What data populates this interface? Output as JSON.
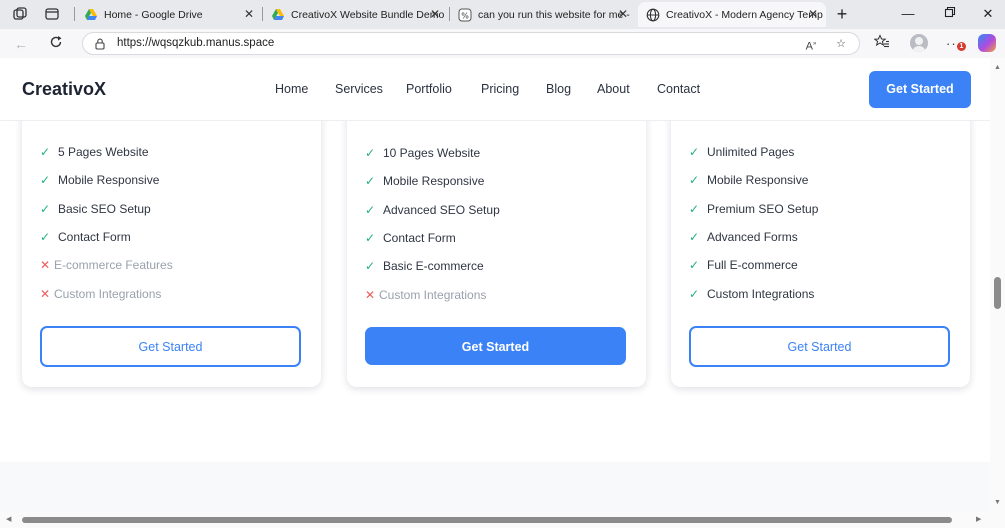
{
  "browser": {
    "tabs": [
      {
        "title": "Home - Google Drive",
        "icon": "google-drive-icon"
      },
      {
        "title": "CreativoX Website Bundle Demo",
        "icon": "google-drive-icon"
      },
      {
        "title": "can you run this website for me -",
        "icon": "manus-icon"
      },
      {
        "title": "CreativoX - Modern Agency Temp",
        "icon": "globe-icon",
        "active": true
      }
    ],
    "url": "https://wqsqzkub.manus.space",
    "notification_count": "1"
  },
  "site": {
    "logo": "CreativoX",
    "nav": [
      "Home",
      "Services",
      "Portfolio",
      "Pricing",
      "Blog",
      "About",
      "Contact"
    ],
    "cta": "Get Started"
  },
  "pricing": {
    "cards": [
      {
        "features": [
          {
            "text": "5 Pages Website",
            "included": true
          },
          {
            "text": "Mobile Responsive",
            "included": true
          },
          {
            "text": "Basic SEO Setup",
            "included": true
          },
          {
            "text": "Contact Form",
            "included": true
          },
          {
            "text": "E-commerce Features",
            "included": false
          },
          {
            "text": "Custom Integrations",
            "included": false
          }
        ],
        "button": "Get Started",
        "button_style": "outline"
      },
      {
        "features": [
          {
            "text": "10 Pages Website",
            "included": true
          },
          {
            "text": "Mobile Responsive",
            "included": true
          },
          {
            "text": "Advanced SEO Setup",
            "included": true
          },
          {
            "text": "Contact Form",
            "included": true
          },
          {
            "text": "Basic E-commerce",
            "included": true
          },
          {
            "text": "Custom Integrations",
            "included": false
          }
        ],
        "button": "Get Started",
        "button_style": "solid"
      },
      {
        "features": [
          {
            "text": "Unlimited Pages",
            "included": true
          },
          {
            "text": "Mobile Responsive",
            "included": true
          },
          {
            "text": "Premium SEO Setup",
            "included": true
          },
          {
            "text": "Advanced Forms",
            "included": true
          },
          {
            "text": "Full E-commerce",
            "included": true
          },
          {
            "text": "Custom Integrations",
            "included": true
          }
        ],
        "button": "Get Started",
        "button_style": "outline"
      }
    ]
  },
  "colors": {
    "accent": "#3b82f6",
    "check": "#22b07a",
    "cross": "#ef5b5b"
  }
}
